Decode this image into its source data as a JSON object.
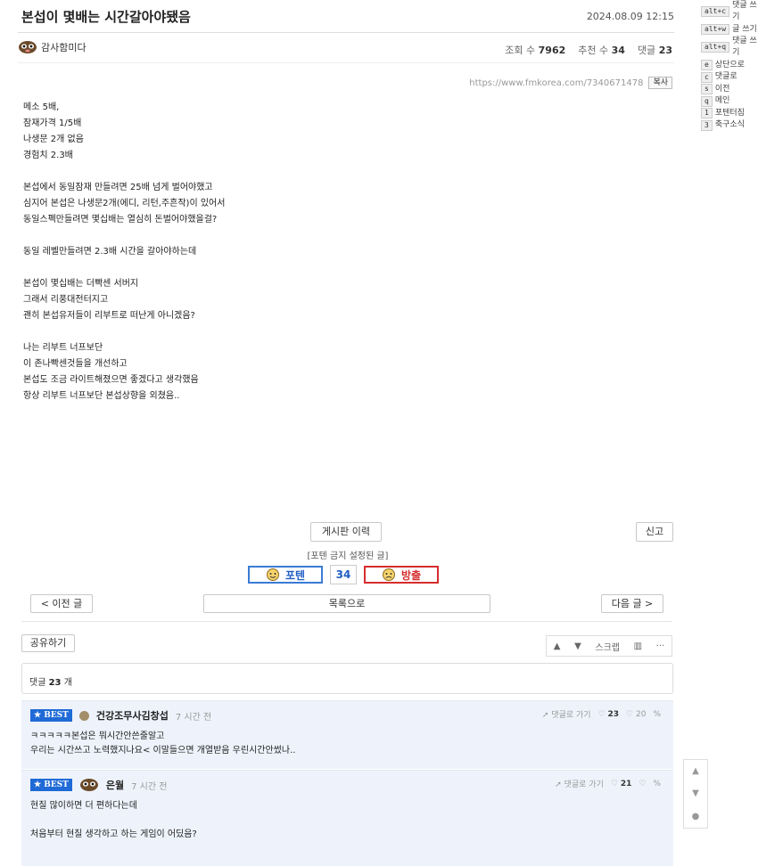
{
  "post": {
    "title": "본섭이 몇배는 시간갈아야됐음",
    "date": "2024.08.09 12:15",
    "author": "감사함미다",
    "views_label": "조회 수",
    "views": "7962",
    "recommend_label": "추천 수",
    "recommend": "34",
    "comments_label": "댓글",
    "comments": "23",
    "url": "https://www.fmkorea.com/7340671478",
    "copy_label": "복사",
    "paragraphs": [
      "메소 5배,\n잠재가격 1/5배\n나생문 2개 없음\n경험치 2.3배",
      "본섭에서 동일잠재 만들려면 25배 넘게 벌어야했고\n심지어 본섭은 나생문2개(에디, 리턴,주흔작)이 있어서\n동일스펙만들려면 몇십배는 열심히 돈벌어야했을걸?",
      "동일 레벨만들려면 2.3배 시간을 갈아야하는데",
      "본섭이 몇십배는 더빡센 서버지\n그래서 리풍대전터지고\n괜히 본섭유저들이 리부트로 떠난게 아니겠음?",
      "나는 리부트 너프보단\n이 존나빡센것들을 개선하고\n본섭도 조금 라이트해졌으면 좋겠다고 생각했음\n항상 리부트 너프보단 본섭상향을 외쳤음.."
    ]
  },
  "shortcuts": [
    {
      "key": "alt+c",
      "label": "댓글 쓰기"
    },
    {
      "key": "alt+w",
      "label": "글 쓰기"
    },
    {
      "key": "alt+q",
      "label": "댓글 쓰기"
    },
    {
      "key": "e",
      "label": "상단으로"
    },
    {
      "key": "c",
      "label": "댓글로"
    },
    {
      "key": "s",
      "label": "이전"
    },
    {
      "key": "q",
      "label": "메인"
    },
    {
      "key": "1",
      "label": "포텐터짐"
    },
    {
      "key": "3",
      "label": "축구소식"
    }
  ],
  "actions": {
    "history": "게시판 이력",
    "report": "신고",
    "vote_note": "[포텐 금지 설정된 글]",
    "vote_up": "포텐",
    "vote_count": "34",
    "vote_down": "방출",
    "prev": "< 이전 글",
    "list": "목록으로",
    "next": "다음 글 >",
    "share": "공유하기",
    "scrap": "스크랩"
  },
  "comments_section": {
    "count_label": "댓글",
    "count": "23",
    "count_unit": "개",
    "items": [
      {
        "badge": "★ BEST",
        "name": "건강조무사김창섭",
        "time": "7 시간 전",
        "goto": "댓글로 가기",
        "up": "23",
        "down": "20",
        "text": "ㅋㅋㅋㅋㅋ본섭은 뭐시간안쓴줄알고\n우리는 시간쓰고 노력했지나요< 이말들으면 개열받음 우린시간안썼나.."
      },
      {
        "badge": "★ BEST",
        "name": "은월",
        "time": "7 시간 전",
        "goto": "댓글로 가기",
        "up": "21",
        "down": "",
        "text": "현질 많이하면 더 편하다는데\n\n처음부터 현질 생각하고 하는 게임이 어딨음?"
      }
    ]
  }
}
